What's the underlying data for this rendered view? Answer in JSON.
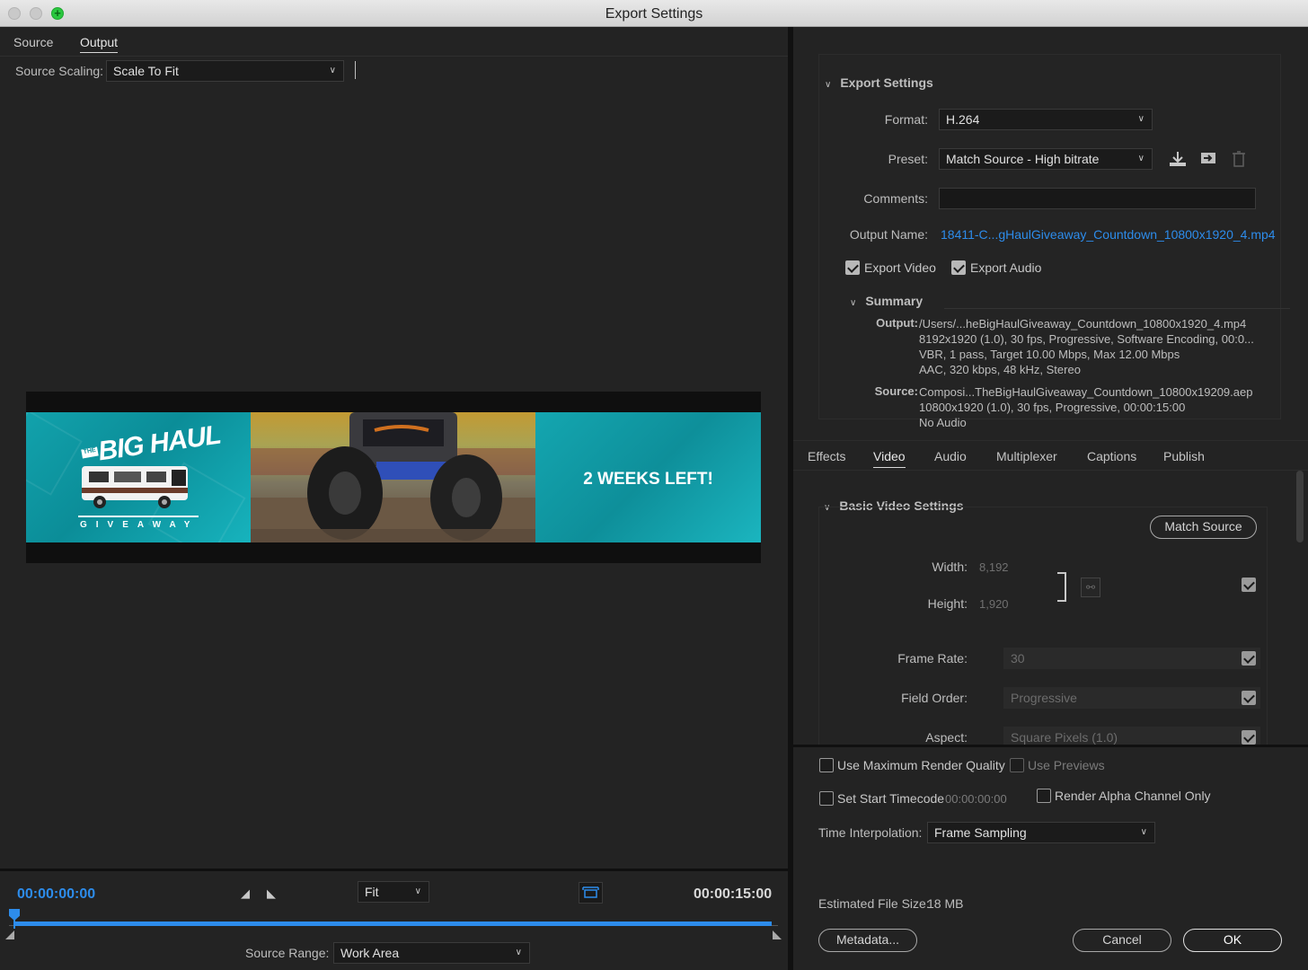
{
  "window": {
    "title": "Export Settings"
  },
  "left": {
    "tabs": [
      {
        "label": "Source"
      },
      {
        "label": "Output"
      }
    ],
    "source_scaling": {
      "label": "Source Scaling:",
      "value": "Scale To Fit"
    },
    "preview": {
      "brand_big": "BIG HAUL",
      "brand_the": "THE",
      "brand_give": "GIVEAWAY",
      "banner_text": "2 WEEKS LEFT!"
    },
    "timeline": {
      "current_time": "00:00:00:00",
      "end_time": "00:00:15:00",
      "zoom": "Fit",
      "source_range_label": "Source Range:",
      "source_range_value": "Work Area",
      "playhead_fraction": 0.0
    }
  },
  "export_settings": {
    "section_title": "Export Settings",
    "format_label": "Format:",
    "format_value": "H.264",
    "preset_label": "Preset:",
    "preset_value": "Match Source - High bitrate",
    "comments_label": "Comments:",
    "comments_value": "",
    "output_name_label": "Output Name:",
    "output_name_value": "18411-C...gHaulGiveaway_Countdown_10800x1920_4.mp4",
    "export_video": {
      "label": "Export Video",
      "checked": true
    },
    "export_audio": {
      "label": "Export Audio",
      "checked": true
    },
    "summary": {
      "title": "Summary",
      "output_label": "Output:",
      "output_lines": [
        "/Users/...heBigHaulGiveaway_Countdown_10800x1920_4.mp4",
        "8192x1920 (1.0), 30 fps, Progressive, Software Encoding, 00:0...",
        "VBR, 1 pass, Target 10.00 Mbps, Max 12.00 Mbps",
        "AAC, 320 kbps, 48 kHz, Stereo"
      ],
      "source_label": "Source:",
      "source_lines": [
        "Composi...TheBigHaulGiveaway_Countdown_10800x19209.aep",
        "10800x1920 (1.0), 30 fps, Progressive, 00:00:15:00",
        "No Audio"
      ]
    }
  },
  "right_tabs": [
    {
      "label": "Effects"
    },
    {
      "label": "Video"
    },
    {
      "label": "Audio"
    },
    {
      "label": "Multiplexer"
    },
    {
      "label": "Captions"
    },
    {
      "label": "Publish"
    }
  ],
  "basic_video": {
    "title": "Basic Video Settings",
    "match_source": "Match Source",
    "width_label": "Width:",
    "width_value": "8,192",
    "height_label": "Height:",
    "height_value": "1,920",
    "frame_rate_label": "Frame Rate:",
    "frame_rate_value": "30",
    "field_order_label": "Field Order:",
    "field_order_value": "Progressive",
    "aspect_label": "Aspect:",
    "aspect_value": "Square Pixels (1.0)"
  },
  "bottom": {
    "max_render_quality": {
      "label": "Use Maximum Render Quality",
      "checked": false
    },
    "use_previews": {
      "label": "Use Previews",
      "checked": false
    },
    "set_start_timecode": {
      "label": "Set Start Timecode",
      "checked": false,
      "value": "00:00:00:00"
    },
    "render_alpha": {
      "label": "Render Alpha Channel Only",
      "checked": false
    },
    "time_interpolation_label": "Time Interpolation:",
    "time_interpolation_value": "Frame Sampling",
    "file_size_label": "Estimated File Size:",
    "file_size_value": "18 MB",
    "metadata_button": "Metadata...",
    "cancel_button": "Cancel",
    "ok_button": "OK"
  },
  "colors": {
    "accent": "#2d8ceb",
    "background": "#232323",
    "banner_teal": "#12a2ac"
  },
  "icons": [
    "close-icon",
    "minimize-icon",
    "zoom-icon",
    "chevron-down-icon",
    "import-preset-icon",
    "save-preset-icon",
    "delete-preset-icon",
    "link-icon",
    "set-in-point-icon",
    "set-out-point-icon",
    "aspect-toggle-icon"
  ]
}
